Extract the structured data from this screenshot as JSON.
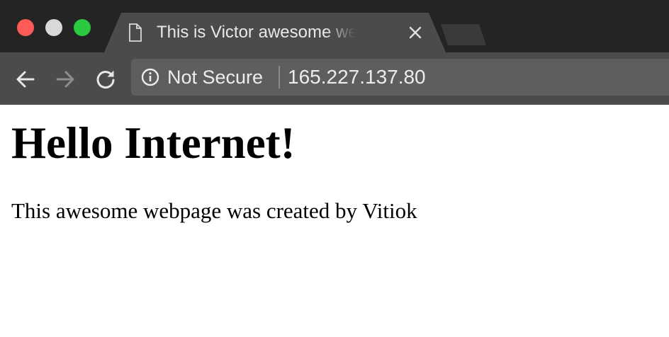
{
  "window": {
    "controls": [
      "close",
      "minimize",
      "maximize"
    ]
  },
  "tab": {
    "title": "This is Victor awesome webpage",
    "icon": "file-icon",
    "close_icon": "close-icon"
  },
  "toolbar": {
    "back_icon": "arrow-left-icon",
    "forward_icon": "arrow-right-icon",
    "reload_icon": "reload-icon"
  },
  "address_bar": {
    "security_icon": "info-circle-icon",
    "security_label": "Not Secure",
    "url": "165.227.137.80"
  },
  "page": {
    "heading": "Hello Internet!",
    "paragraph": "This awesome webpage was created by Vitiok"
  },
  "colors": {
    "titlebar": "#242424",
    "toolbar": "#4b4b4b",
    "omnibox": "#5e5e5e",
    "close": "#fc5b57",
    "minimize": "#d9d9d9",
    "maximize": "#2ac940"
  }
}
